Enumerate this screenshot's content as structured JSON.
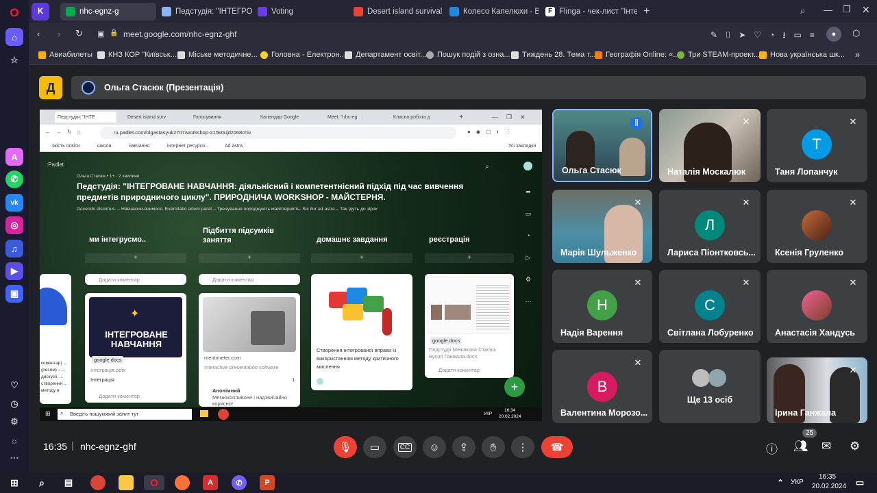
{
  "browser": {
    "tabs": [
      {
        "label": "nhc-egnz-g",
        "active": true
      },
      {
        "label": "Педстудія: \"ІНТЕГРОВАНЕ",
        "active": false
      },
      {
        "label": "Voting",
        "active": false
      },
      {
        "label": "Desert island survival - M",
        "active": false
      },
      {
        "label": "Колесо Капелюхи - Випа",
        "active": false
      },
      {
        "label": "Flinga - чек-лист \"Інтегро",
        "active": false
      }
    ],
    "url": "meet.google.com/nhc-egnz-ghf",
    "bookmarks": [
      "Авиабилеты",
      "КНЗ КОР \"Київськ...",
      "Міське методичне...",
      "Головна - Електрон...",
      "Департамент освіт...",
      "Пошук подій з озна...",
      "Тиждень 28. Тема т...",
      "Географія Online: «...",
      "Три STEAM-проект...",
      "Нова українська шк..."
    ]
  },
  "meet": {
    "presenter_title": "Ольга Стасюк (Презентація)",
    "logo_letter": "Д",
    "time": "16:35",
    "meeting_code": "nhc-egnz-ghf",
    "participants_count": "25",
    "colors": {
      "end_call": "#ea4335",
      "mic_off": "#ea4335",
      "accent_blue": "#8ab4f8"
    },
    "participants": [
      {
        "name": "Ольга Стасюк",
        "type": "video",
        "speaking": true
      },
      {
        "name": "Наталія Москалюк",
        "type": "video"
      },
      {
        "name": "Таня Лопанчук",
        "type": "avatar",
        "letter": "Т",
        "color": "#039be5"
      },
      {
        "name": "Марія Шульженко",
        "type": "video"
      },
      {
        "name": "Лариса Піонтковсь...",
        "type": "avatar",
        "letter": "Л",
        "color": "#00897b"
      },
      {
        "name": "Ксенія Груленко",
        "type": "photo"
      },
      {
        "name": "Надія Варення",
        "type": "avatar",
        "letter": "Н",
        "color": "#43a047"
      },
      {
        "name": "Світлана Лобуренко",
        "type": "avatar",
        "letter": "С",
        "color": "#00838f"
      },
      {
        "name": "Анастасія Хандусь",
        "type": "photo"
      },
      {
        "name": "Валентина Морозо...",
        "type": "avatar",
        "letter": "В",
        "color": "#d81b60"
      },
      {
        "name": "Ще 13 осіб",
        "type": "more"
      },
      {
        "name": "Ірина Ганжала",
        "type": "video"
      }
    ]
  },
  "shared": {
    "tabs": [
      "Педстудія: \"ІНТЕ",
      "Desert island surv",
      "Голосування",
      "Календар Google",
      "Meet: \"nhc-eg",
      "Класна робота д"
    ],
    "url": "ru.padlet.com/olgastasyuk2707/workshop-215k0ujdzb68chiv",
    "bookmarks": [
      "якість освіти",
      "школа",
      "навчання",
      "інтернет ресурси...",
      "Ad astra",
      "Усі закладки"
    ],
    "padlet_label": ":Padlet",
    "author": "Ольга Стасюк • 1+ · 2 хвилини",
    "title": "Педстудія: \"ІНТЕГРОВАНЕ НАВЧАННЯ: діяльнісний і компетентнісний підхід під час вивчення предметів природничого циклу\". ПРИРОДНИЧА WORKSHOP - МАЙСТЕРНЯ.",
    "subtitle": "Docendo discimus. – Навчаючи-вчимося. Exercitatio artem parat – Тренування породжують майстерність. Sic itur ad astra – Так ідуть до зірок",
    "columns": [
      "ми інтегрусмо..",
      "Підбиття підсумків заняття",
      "домашнє завдання",
      "реєстрація"
    ],
    "add_comment": "Додати коментар",
    "cards": {
      "c1_title": "ІНТЕГРОВАНЕ НАВЧАННЯ",
      "c1_source": "google docs",
      "c1_file": "Інтеграція.pptx",
      "c1_caption": "Інтеграція",
      "c2_source": "mentimeter.com",
      "c2_caption": "Interactive presentation software",
      "c2_author": "Анонімний",
      "c2_comment": "Мегаохопливоне і надзвичайно корисно! ",
      "c2_count": "1",
      "c3_caption": "Створення інтегрованої вправи із використанням методу критичного мислення",
      "c4_source": "google docs",
      "c4_caption": "Педстудії Межакова Стасюк Бусол Ганжала.docx",
      "left_partial": "коментар) ... (ресом) – ... дискусії, ... створення ... методу в"
    },
    "win_search": "Введіть пошуковий запит тут",
    "win_time": "16:34",
    "win_date": "20.02.2024",
    "win_lang": "УКР"
  },
  "taskbar": {
    "lang": "УКР",
    "time": "16:35",
    "date": "20.02.2024"
  }
}
